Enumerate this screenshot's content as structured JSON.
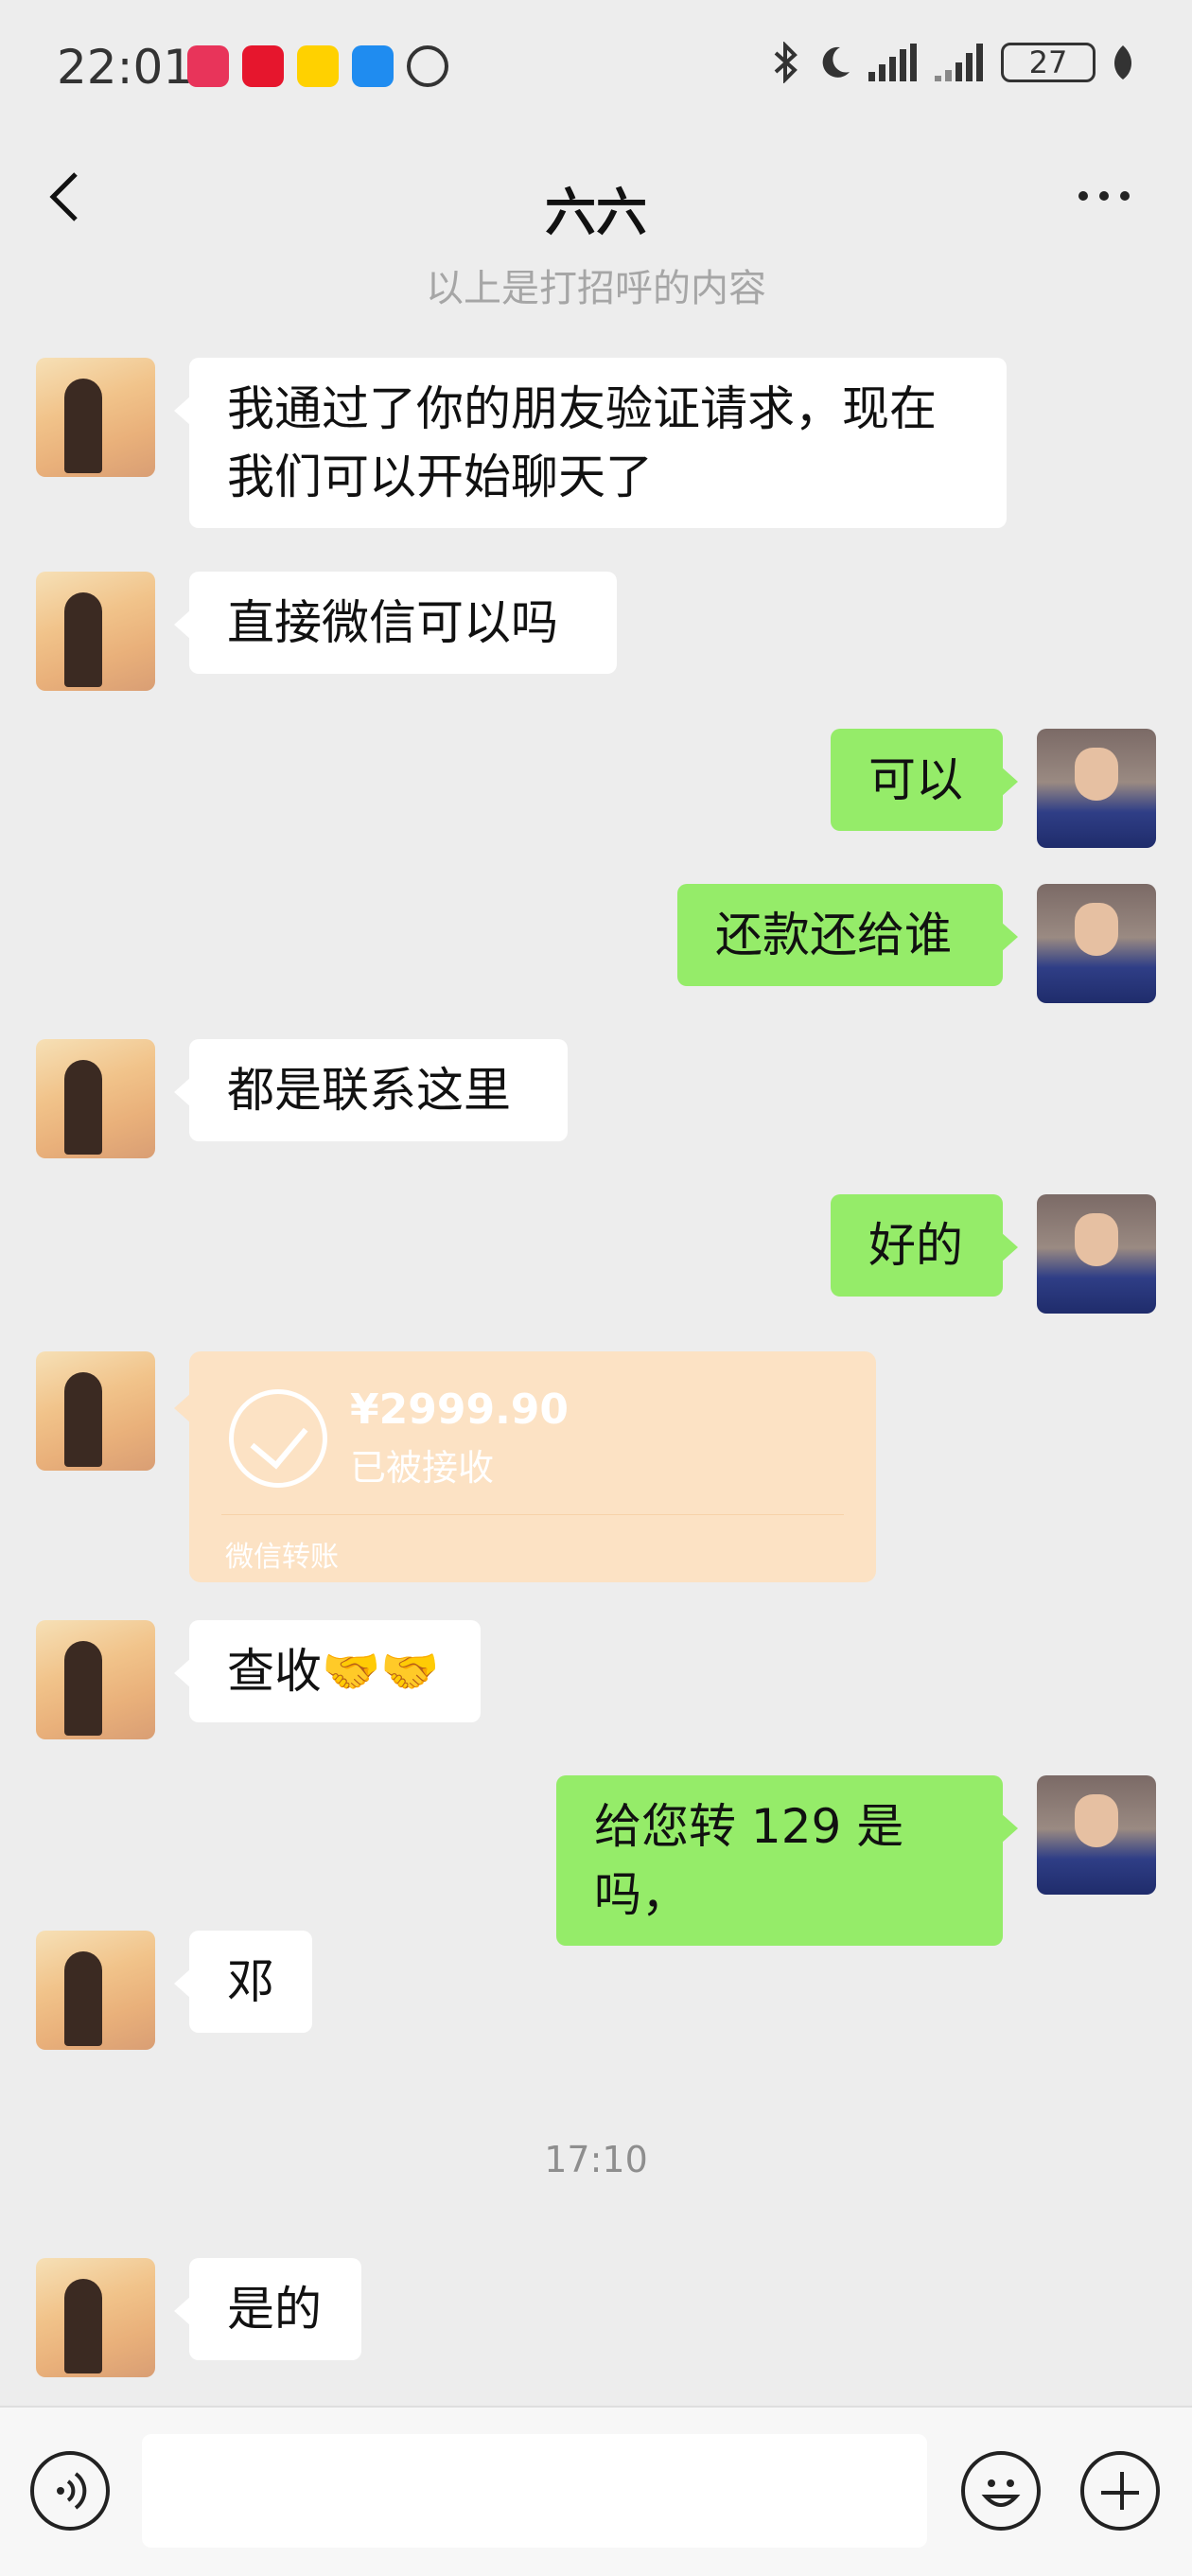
{
  "status": {
    "time": "22:01",
    "battery": "27"
  },
  "header": {
    "title": "六六"
  },
  "system": {
    "greeting_note": "以上是打招呼的内容",
    "timestamp": "17:10"
  },
  "messages": [
    {
      "side": "left",
      "text": "我通过了你的朋友验证请求，现在我们可以开始聊天了"
    },
    {
      "side": "left",
      "text": "直接微信可以吗"
    },
    {
      "side": "right",
      "text": "可以"
    },
    {
      "side": "right",
      "text": "还款还给谁"
    },
    {
      "side": "left",
      "text": "都是联系这里"
    },
    {
      "side": "right",
      "text": "好的"
    },
    {
      "side": "left",
      "text": "查收🤝🤝"
    },
    {
      "side": "right",
      "text": "给您转 129 是吗，"
    },
    {
      "side": "left",
      "text": "邓"
    },
    {
      "side": "left",
      "text": "是的"
    }
  ],
  "transfer": {
    "amount": "¥2999.90",
    "status": "已被接收",
    "label": "微信转账"
  },
  "icons": {
    "back": "chevron-left-icon",
    "more": "more-dots-icon",
    "voice": "voice-icon",
    "emoji": "emoji-icon",
    "plus": "plus-icon"
  },
  "colors": {
    "background": "#ededed",
    "bubble_right": "#95ec69",
    "bubble_left": "#ffffff",
    "transfer": "#fce2c4"
  }
}
